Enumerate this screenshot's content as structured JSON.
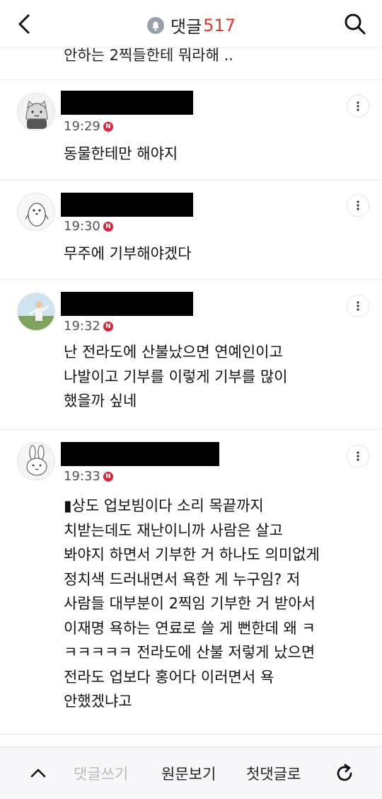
{
  "header": {
    "title": "댓글",
    "count": "517"
  },
  "previous_comment_tail": "안하는 2찍들한테 뭐라해 ..",
  "comments": [
    {
      "time": "19:29",
      "text": "동물한테만 해야지"
    },
    {
      "time": "19:30",
      "text": "무주에 기부해야겠다"
    },
    {
      "time": "19:32",
      "text": "난 전라도에 산불났으면 연예인이고\n나발이고 기부를 이렇게 기부를 많이\n했을까 싶네"
    },
    {
      "time": "19:33",
      "text": "▮상도 업보빔이다 소리 목끝까지\n치받는데도 재난이니까 사람은 살고\n봐야지 하면서 기부한 거 하나도 의미없게\n정치색 드러내면서 욕한 게 누구임? 저\n사람들 대부분이 2찍임 기부한 거 받아서\n이재명 욕하는 연료로 쓸 게 뻔한데 왜 ㅋ\nㅋㅋㅋㅋㅋ 전라도에 산불 저렇게 났으면\n전라도 업보다 홍어다 이러면서 욕\n안했겠냐고"
    }
  ],
  "badge_letter": "N",
  "bottom_bar": {
    "write_label": "댓글쓰기",
    "original_label": "원문보기",
    "first_label": "첫댓글로"
  },
  "colors": {
    "accent": "#d33a2c",
    "badge": "#d7263d",
    "redaction": "#000000"
  },
  "icons": [
    "back-arrow-icon",
    "bell-icon",
    "search-icon",
    "more-vertical-icon",
    "chevron-up-icon",
    "refresh-icon"
  ]
}
